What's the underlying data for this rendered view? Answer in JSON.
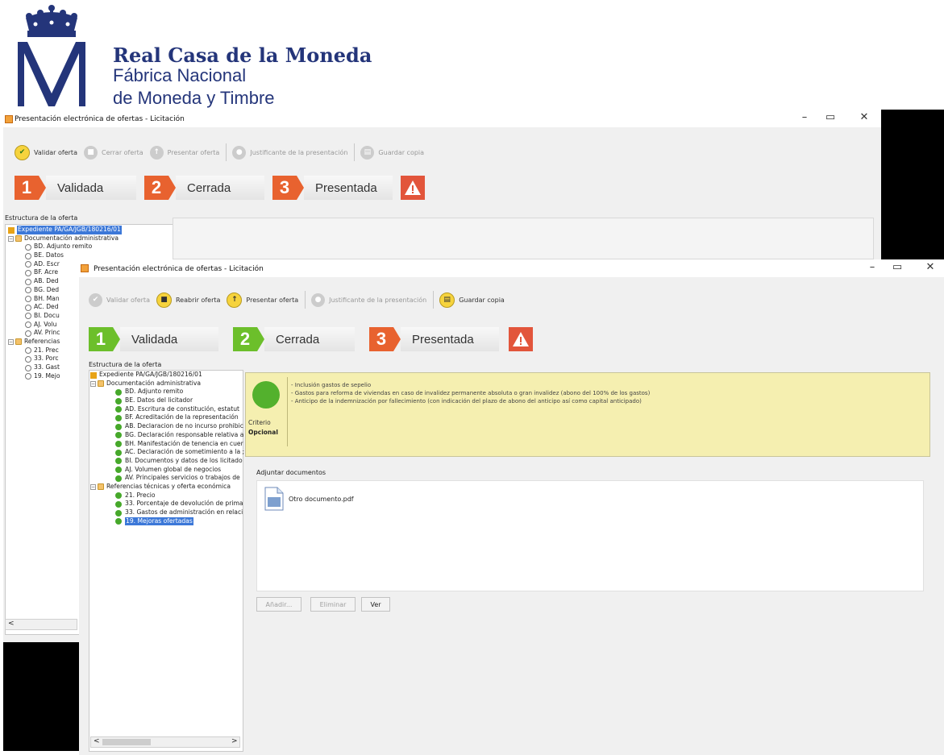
{
  "brand": {
    "line1": "Real Casa de la Moneda",
    "line2": "Fábrica Nacional",
    "line3": "de Moneda y Timbre"
  },
  "colors": {
    "step_orange": "#e8622f",
    "step_green": "#6cbf2b",
    "warning_red": "#e2553b",
    "accent_blue": "#3c78d8",
    "brand_blue": "#24357a"
  },
  "back_window": {
    "title": "Presentación electrónica de ofertas - Licitación",
    "controls": {
      "minimize": "–",
      "restore": "▭",
      "close": "✕"
    },
    "toolbar": [
      {
        "label": "Validar oferta",
        "icon": "check-icon",
        "enabled": true
      },
      {
        "label": "Cerrar oferta",
        "icon": "lock-icon",
        "enabled": false
      },
      {
        "label": "Presentar oferta",
        "icon": "upload-icon",
        "enabled": false
      },
      {
        "label": "Justificante de la presentación",
        "icon": "receipt-icon",
        "enabled": false
      },
      {
        "label": "Guardar copia",
        "icon": "save-icon",
        "enabled": false
      }
    ],
    "steps": [
      {
        "num": "1",
        "label": "Validada"
      },
      {
        "num": "2",
        "label": "Cerrada"
      },
      {
        "num": "3",
        "label": "Presentada"
      }
    ],
    "structure_label": "Estructura de la oferta",
    "tree": {
      "root": "Expediente PA/GA/JGB/180216/01",
      "group1": "Documentación administrativa",
      "group1_items": [
        "BD. Adjunto remito",
        "BE. Datos",
        "AD. Escr",
        "BF. Acre",
        "AB. Ded",
        "BG. Ded",
        "BH. Man",
        "AC. Ded",
        "BI. Docu",
        "AJ. Volu",
        "AV. Princ"
      ],
      "group2": "Referencias",
      "group2_items": [
        "21. Prec",
        "33. Porc",
        "33. Gast",
        "19. Mejo"
      ]
    },
    "scroll_left": "<"
  },
  "front_window": {
    "title": "Presentación electrónica de ofertas - Licitación",
    "controls": {
      "minimize": "–",
      "restore": "▭",
      "close": "✕"
    },
    "toolbar": [
      {
        "label": "Validar oferta",
        "icon": "check-icon",
        "enabled": false
      },
      {
        "label": "Reabrir oferta",
        "icon": "unlock-icon",
        "enabled": true
      },
      {
        "label": "Presentar oferta",
        "icon": "upload-icon",
        "enabled": true
      },
      {
        "label": "Justificante de la presentación",
        "icon": "receipt-icon",
        "enabled": false
      },
      {
        "label": "Guardar copia",
        "icon": "save-icon",
        "enabled": true
      }
    ],
    "steps": [
      {
        "num": "1",
        "label": "Validada"
      },
      {
        "num": "2",
        "label": "Cerrada"
      },
      {
        "num": "3",
        "label": "Presentada"
      }
    ],
    "structure_label": "Estructura de la oferta",
    "tree": {
      "root": "Expediente PA/GA/JGB/180216/01",
      "group1": "Documentación administrativa",
      "group1_items": [
        "BD. Adjunto remito",
        "BE. Datos del licitador",
        "AD. Escritura de constitución, estatut",
        "BF. Acreditación de la representación",
        "AB. Declaracion de no incurso prohibic",
        "BG. Declaración responsable relativa a",
        "BH. Manifestación de tenencia en cuer",
        "AC. Declaración de sometimiento a la ;",
        "BI. Documentos y datos de los licitado",
        "AJ. Volumen global de negocios",
        "AV. Principales servicios o trabajos de"
      ],
      "group2": "Referencias técnicas y oferta económica",
      "group2_items": [
        "21. Precio",
        "33. Porcentaje de devolución de prima",
        "33. Gastos de administración en relaci",
        "19. Mejoras ofertadas"
      ],
      "selected": "19. Mejoras ofertadas"
    },
    "criterion": {
      "lines": [
        "- Inclusión gastos de sepelio",
        "- Gastos para reforma de viviendas en caso de invalidez permanente absoluta o gran invalidez (abono del 100% de los gastos)",
        "- Anticipo de la indemnización por fallecimiento (con indicación del plazo de abono del anticipo así como capital anticipado)"
      ],
      "label": "Criterio",
      "value": "Opcional"
    },
    "attach_label": "Adjuntar documentos",
    "file": {
      "name": "Otro documento.pdf",
      "icon": "document-icon"
    },
    "buttons": {
      "add": "Añadir...",
      "delete": "Eliminar",
      "view": "Ver"
    },
    "scroll_left": "<",
    "scroll_right": ">"
  }
}
